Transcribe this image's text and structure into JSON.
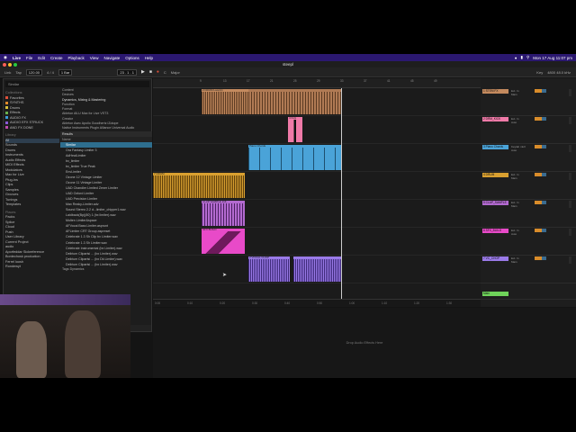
{
  "menubar": {
    "items": [
      "Live",
      "File",
      "Edit",
      "Create",
      "Playback",
      "View",
      "Navigate",
      "Options",
      "Help"
    ],
    "datetime": "Mon 17 Aug 11:07 pm"
  },
  "window_title": "steepl",
  "transport": {
    "link": "Link",
    "tap": "Tap",
    "tempo": "120.00",
    "sig": "4 / 4",
    "bar": "1 Bar",
    "position": "23 . 1 . 1",
    "key": "C",
    "scale": "Major",
    "cpu": "4800 48.0 kHz",
    "key_label": "Key"
  },
  "browser": {
    "search": "Similar",
    "collections_hdr": "Collections",
    "collections": [
      {
        "label": "Favorites",
        "color": "#e0503a"
      },
      {
        "label": "SYNTHS",
        "color": "#e08a2a"
      },
      {
        "label": "Drums",
        "color": "#d8c13a"
      },
      {
        "label": "Effects",
        "color": "#6ab04c"
      },
      {
        "label": "AUDIO FX",
        "color": "#3a9bd8"
      },
      {
        "label": "AUDIO EFX STRUCK",
        "color": "#8a5ad8"
      },
      {
        "label": "AND FX DONE",
        "color": "#c04ab0"
      }
    ],
    "library_hdr": "Library",
    "library": [
      "All",
      "Sounds",
      "Drums",
      "Instruments",
      "Audio Effects",
      "MIDI Effects",
      "Modulators",
      "Max for Live",
      "Plug-Ins",
      "Clips",
      "Samples",
      "Grooves",
      "Tunings",
      "Templates"
    ],
    "places_hdr": "Places",
    "places": [
      "Packs",
      "Splice",
      "Cloud",
      "Push",
      "User Library",
      "Current Project",
      "audio",
      "Aporfeddar Sickreference",
      "Bontechosk production",
      "Ferrel loosh",
      "Rondewyt"
    ],
    "filters": [
      "Content",
      "Devices",
      "Dynamics, Mixing & Mastering",
      "Function",
      "Format",
      "Ableton  All-U  Max for Live  VST3",
      "Creator",
      "Ableton  Asec  Apollo  Goodhertz  iZotope",
      "Native Instruments  Plugin Alliance  Universal Audio"
    ],
    "results_label": "Results",
    "name_col": "Name",
    "results": [
      "Similar",
      "Ora Fantasy Limiter 3",
      "AdHealLimiter",
      "bx_limiter",
      "bx_limiter True Peak",
      "EnvLimiter",
      "Ozone 12 Vintage Limiter",
      "Ozone 11 Vintage Limiter",
      "UAD Chandler Limited Zener Limiter",
      "UAD Oxford Limiter",
      "UAD Precision Limiter",
      "Max Reaky-Limiter.adv",
      "Sound Stereo 2.2 d...limiter_chipper1.wav",
      "Laidback(Bp)(80) 1 (bx limiter).wav",
      "Molten Limiter&space",
      "AFVocal Bass Limiter.asprunt",
      "AFLimiter CRT Group.aspreset",
      "Celebrate 1.3 Sh Clip bx Limiter.wav",
      "Celebrate 1.3 Sh Limiter.wav",
      "Celebrate Instrumental (bx Limiter).wav",
      "Delirium Clipartsi ... (bx Limiter).wav",
      "Delirium Clipartsi ... (bx Dk Limiter).wav",
      "Delirium Clipartsi ... (bx Limiter).wav"
    ],
    "footer": "1 item selected",
    "tags": "Tags  Dynamics"
  },
  "arrangement": {
    "ruler": [
      "9",
      "13",
      "17",
      "21",
      "25",
      "29",
      "33",
      "37",
      "41",
      "45",
      "49"
    ],
    "bottom_ruler": [
      "0:00",
      "0:10",
      "0:20",
      "0:30",
      "0:40",
      "0:50",
      "1:00",
      "1:10",
      "1:20",
      "1:30",
      "1:40",
      "1:50"
    ],
    "clips": [
      {
        "name": "2 DRUM Loop(s)",
        "color": "#c48a5e",
        "lane": 0
      },
      {
        "name": "4 Kick",
        "color": "#f07aa8",
        "lane": 1
      },
      {
        "name": "Piano Chords",
        "color": "#4aa3d8",
        "lane": 2
      },
      {
        "name": "7 DRUM",
        "color": "#d9a030",
        "lane": 3
      },
      {
        "name": "CLAP SAMPLE 116",
        "color": "#b36ad0",
        "lane": 4
      },
      {
        "name": "SFX BUILD",
        "color": "#e84ac8",
        "lane": 5
      },
      {
        "name": "2 VOCAL CHOP",
        "color": "#9a7ae8",
        "lane": 6
      }
    ],
    "drop_hint": "Drop Audio Effects Here"
  },
  "mixer": {
    "tracks": [
      {
        "name": "1 STEM FX",
        "color": "#c48a5e",
        "routing": "Ext. In",
        "mode": "Main"
      },
      {
        "name": "2 DRM_KICK",
        "color": "#f07aa8",
        "routing": "Ext. In",
        "mode": "Auto"
      },
      {
        "name": "3 Piano Chords",
        "color": "#4aa3d8",
        "routing": "Keylab mkII",
        "mode": "Auto"
      },
      {
        "name": "4 DRUM",
        "color": "#d9a030",
        "routing": "Ext. In",
        "mode": "Main"
      },
      {
        "name": "5 CLAP_SAMPLE",
        "color": "#b36ad0",
        "routing": "Ext. In",
        "mode": "Main"
      },
      {
        "name": "6 SFX_BUILD",
        "color": "#e84ac8",
        "routing": "Ext. In",
        "mode": "Auto"
      },
      {
        "name": "7 VC_CHOP",
        "color": "#9a7ae8",
        "routing": "Ext. In",
        "mode": "Main"
      }
    ],
    "main_label": "Main"
  }
}
